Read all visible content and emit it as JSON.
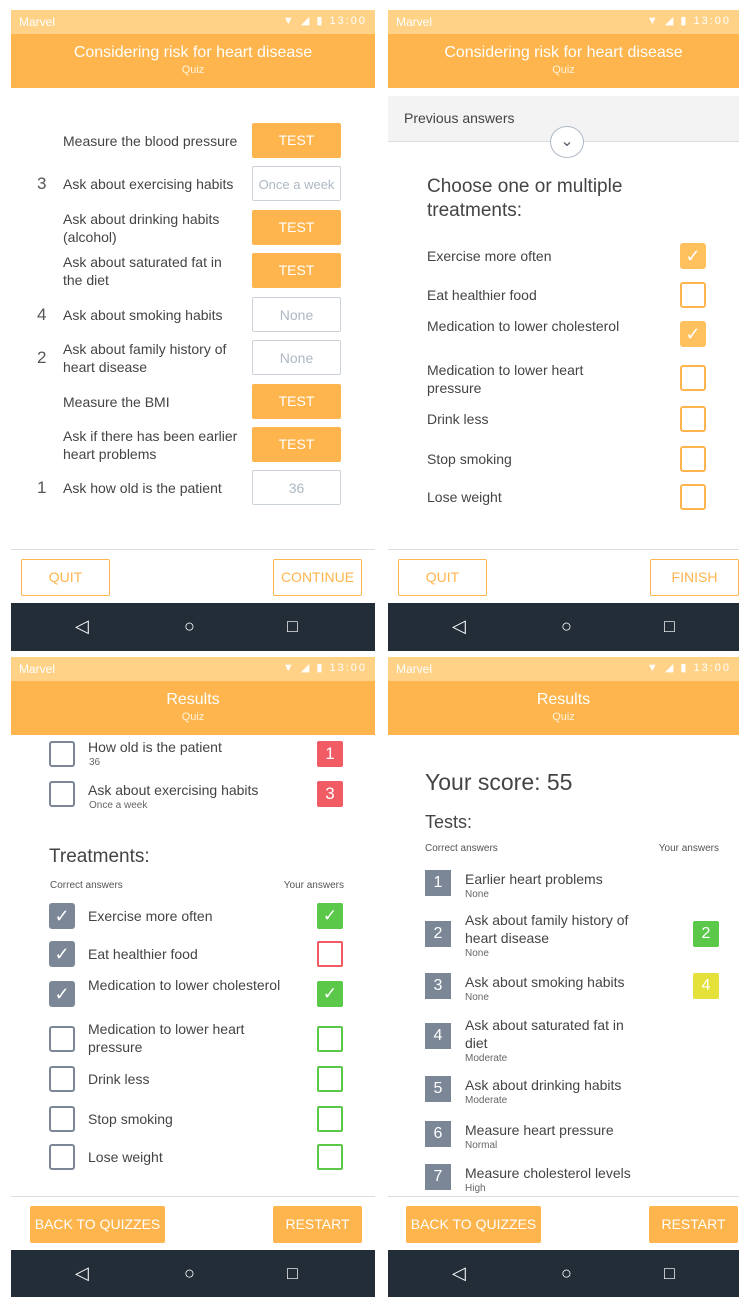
{
  "colors": {
    "accent": "#ffb54d",
    "status_bar": "#ffd287",
    "nav_bar": "#222d38",
    "checkbox_grey": "#7b8796",
    "correct_green": "#5cc84a",
    "wrong_red": "#f05b64",
    "partial_yellow": "#e3e13a"
  },
  "status": {
    "carrier": "Marvel",
    "time": "13:00"
  },
  "screen1": {
    "title": "Considering risk for heart disease",
    "subtitle": "Quiz",
    "rows": [
      {
        "rank": "",
        "label": "Measure the blood pressure",
        "action": "TEST"
      },
      {
        "rank": "3",
        "label": "Ask about exercising habits",
        "action": "Once a week"
      },
      {
        "rank": "",
        "label": "Ask about drinking habits (alcohol)",
        "action": "TEST"
      },
      {
        "rank": "",
        "label": "Ask about saturated fat in the diet",
        "action": "TEST"
      },
      {
        "rank": "4",
        "label": "Ask about smoking habits",
        "action": "None"
      },
      {
        "rank": "2",
        "label": "Ask about family history of heart disease",
        "action": "None"
      },
      {
        "rank": "",
        "label": "Measure the BMI",
        "action": "TEST"
      },
      {
        "rank": "",
        "label": "Ask if there has been earlier heart problems",
        "action": "TEST"
      },
      {
        "rank": "1",
        "label": "Ask how old is the patient",
        "action": "36"
      }
    ],
    "quit": "QUIT",
    "continue": "CONTINUE"
  },
  "screen2": {
    "title": "Considering risk for heart disease",
    "subtitle": "Quiz",
    "previous_answers": "Previous answers",
    "heading": "Choose one or multiple treatments:",
    "treatments": [
      {
        "label": "Exercise more often",
        "checked": true
      },
      {
        "label": "Eat healthier food",
        "checked": false
      },
      {
        "label": "Medication to lower cholesterol",
        "checked": true
      },
      {
        "label": "Medication to lower heart pressure",
        "checked": false
      },
      {
        "label": "Drink less",
        "checked": false
      },
      {
        "label": "Stop smoking",
        "checked": false
      },
      {
        "label": "Lose weight",
        "checked": false
      }
    ],
    "quit": "QUIT",
    "finish": "FINISH"
  },
  "screen3": {
    "title": "Results",
    "subtitle": "Quiz",
    "tests": [
      {
        "label": "How old is the patient",
        "value": "36",
        "answer": "1"
      },
      {
        "label": "Ask about exercising habits",
        "value": "Once a week",
        "answer": "3"
      }
    ],
    "treatments_heading": "Treatments:",
    "correct_answers": "Correct answers",
    "your_answers": "Your answers",
    "treatments": [
      {
        "label": "Exercise more often",
        "correct": true,
        "mine": "correct"
      },
      {
        "label": "Eat healthier food",
        "correct": true,
        "mine": "missed"
      },
      {
        "label": "Medication to lower cholesterol",
        "correct": true,
        "mine": "correct"
      },
      {
        "label": "Medication to lower heart pressure",
        "correct": false,
        "mine": "ok"
      },
      {
        "label": "Drink less",
        "correct": false,
        "mine": "ok"
      },
      {
        "label": "Stop smoking",
        "correct": false,
        "mine": "ok"
      },
      {
        "label": "Lose weight",
        "correct": false,
        "mine": "ok"
      }
    ],
    "back": "BACK TO QUIZZES",
    "restart": "RESTART"
  },
  "screen4": {
    "title": "Results",
    "subtitle": "Quiz",
    "score_label": "Your score: 55",
    "tests_heading": "Tests:",
    "correct_answers": "Correct answers",
    "your_answers": "Your answers",
    "tests": [
      {
        "num": "1",
        "label": "Earlier heart problems",
        "value": "None",
        "answer": "",
        "state": "empty"
      },
      {
        "num": "2",
        "label": "Ask about family history of heart disease",
        "value": "None",
        "answer": "2",
        "state": "green"
      },
      {
        "num": "3",
        "label": "Ask about smoking habits",
        "value": "None",
        "answer": "4",
        "state": "yellow"
      },
      {
        "num": "4",
        "label": "Ask about saturated fat in diet",
        "value": "Moderate",
        "answer": "",
        "state": "empty"
      },
      {
        "num": "5",
        "label": "Ask about drinking habits",
        "value": "Moderate",
        "answer": "",
        "state": "empty"
      },
      {
        "num": "6",
        "label": "Measure heart pressure",
        "value": "Normal",
        "answer": "",
        "state": "empty"
      },
      {
        "num": "7",
        "label": "Measure cholesterol levels",
        "value": "High",
        "answer": "",
        "state": "empty"
      }
    ],
    "back": "BACK TO QUIZZES",
    "restart": "RESTART"
  },
  "nav": {
    "back_icon": "◁",
    "home_icon": "○",
    "recent_icon": "□"
  }
}
